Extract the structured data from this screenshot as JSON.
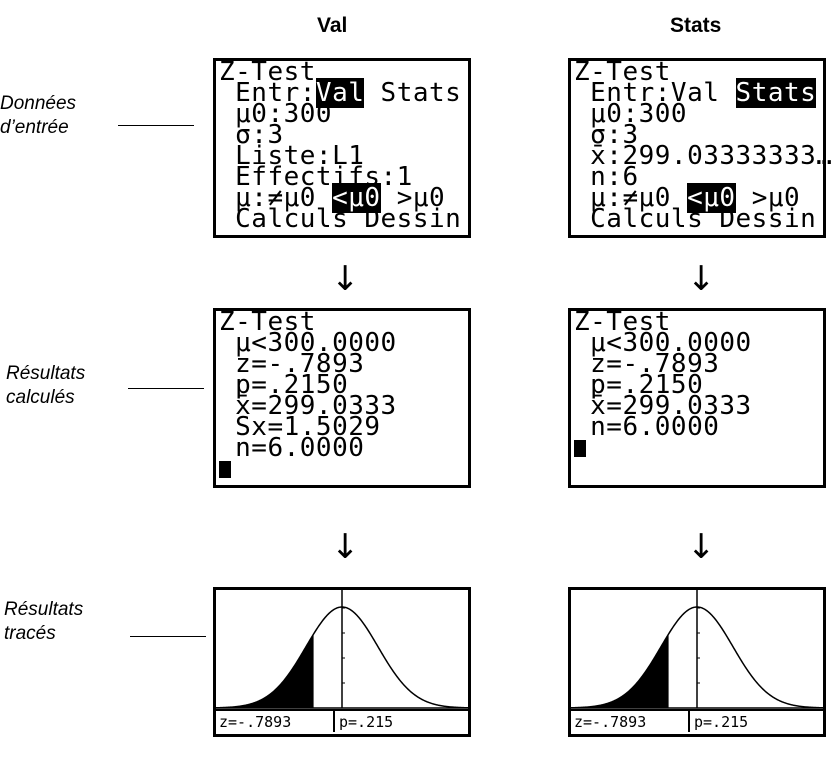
{
  "columns": {
    "val": "Val",
    "stats": "Stats"
  },
  "side_labels": {
    "input": [
      "Données",
      "d’entrée"
    ],
    "calculated": [
      "Résultats",
      "calculés"
    ],
    "drawn": [
      "Résultats",
      "tracés"
    ]
  },
  "arrow_glyph": "↓",
  "input_val": {
    "lines": [
      {
        "text": "Z-Test"
      },
      {
        "pre": " Entr:",
        "hl": "Val",
        "post": " Stats"
      },
      {
        "text": " μ0:300"
      },
      {
        "text": " σ:3"
      },
      {
        "text": " Liste:L1"
      },
      {
        "text": " Effectifs:1"
      },
      {
        "pre": " μ:≠μ0 ",
        "hl": "<μ0",
        "post": " >μ0"
      },
      {
        "text": " Calculs Dessin"
      }
    ]
  },
  "input_stats": {
    "lines": [
      {
        "text": "Z-Test"
      },
      {
        "pre": " Entr:Val ",
        "hl": "Stats",
        "post": ""
      },
      {
        "text": " μ0:300"
      },
      {
        "text": " σ:3"
      },
      {
        "text": " x̄:299.03333333…"
      },
      {
        "text": " n:6"
      },
      {
        "pre": " μ:≠μ0 ",
        "hl": "<μ0",
        "post": " >μ0"
      },
      {
        "text": " Calculs Dessin"
      }
    ]
  },
  "result_val": {
    "lines": [
      "Z-Test",
      " μ<300.0000",
      " z=-.7893",
      " p=.2150",
      " x̄=299.0333",
      " Sx=1.5029",
      " n=6.0000"
    ]
  },
  "result_stats": {
    "lines": [
      "Z-Test",
      " μ<300.0000",
      " z=-.7893",
      " p=.2150",
      " x̄=299.0333",
      " n=6.0000"
    ]
  },
  "graph": {
    "z_label": "z=-.7893",
    "p_label": "p=.215",
    "z_value": -0.7893,
    "p_value": 0.215
  }
}
